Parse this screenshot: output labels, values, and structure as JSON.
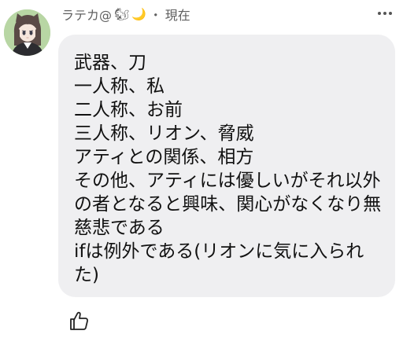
{
  "post": {
    "author_name": "ラテカ@",
    "author_emoji_1": "🐿",
    "author_emoji_2": "🌙",
    "separator": "・",
    "timestamp": "現在",
    "message": "武器、刀\n一人称、私\n二人称、お前\n三人称、リオン、脅威\nアティとの関係、相方\nその他、アティには優しいがそれ以外の者となると興味、関心がなくなり無慈悲である\nifは例外である(リオンに気に入られた)",
    "icons": {
      "avatar": "avatar",
      "more": "more-options-icon",
      "like": "thumbs-up-icon"
    },
    "colors": {
      "bubble": "#efeff1",
      "avatar_bg": "#b8d6a4",
      "text": "#111111",
      "meta": "#606060"
    }
  }
}
